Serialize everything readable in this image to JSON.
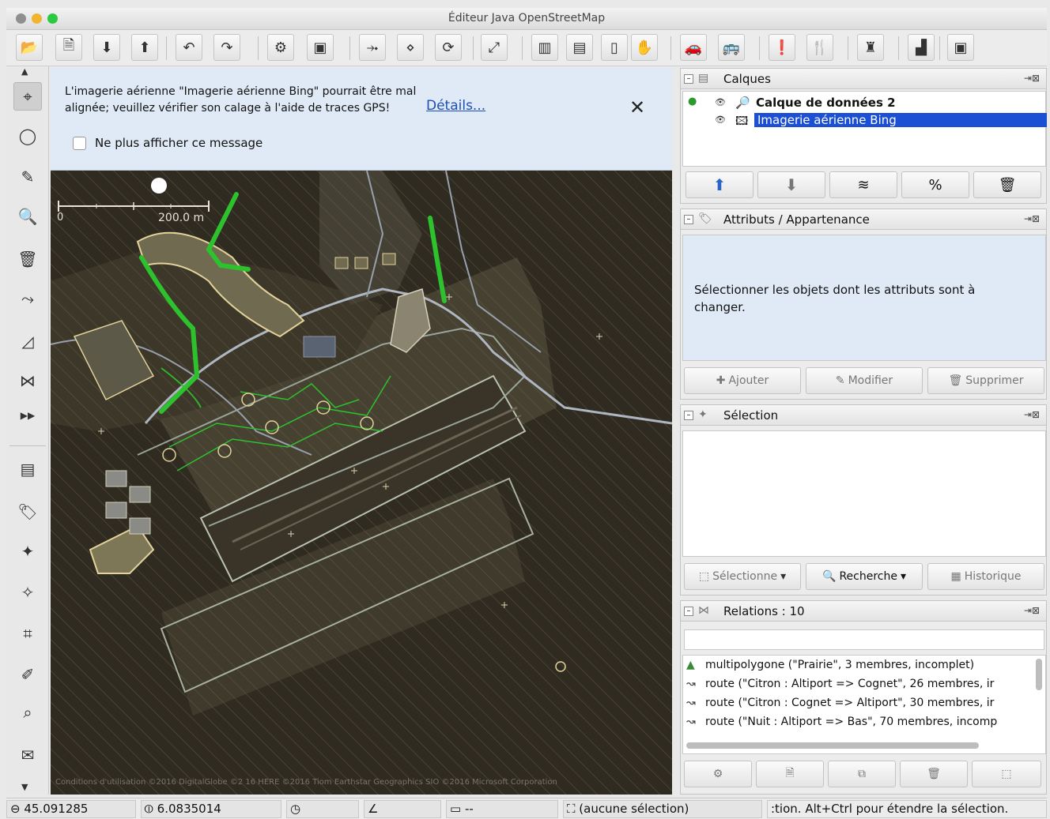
{
  "window": {
    "title": "Éditeur Java OpenStreetMap"
  },
  "toolbar": {
    "buttons": [
      {
        "name": "open-icon",
        "glyph": "📂"
      },
      {
        "name": "open-location-icon",
        "glyph": "🗎"
      },
      {
        "name": "download-icon",
        "glyph": "⬇"
      },
      {
        "name": "upload-icon",
        "glyph": "⬆"
      },
      {
        "name": "undo-icon",
        "glyph": "↶"
      },
      {
        "name": "redo-icon",
        "glyph": "↷"
      },
      {
        "name": "preferences-icon",
        "glyph": "⚙"
      },
      {
        "name": "expert-icon",
        "glyph": "▣"
      },
      {
        "name": "tracks-icon",
        "glyph": "⤞"
      },
      {
        "name": "nodes-icon",
        "glyph": "⋄"
      },
      {
        "name": "refresh-icon",
        "glyph": "⟳"
      },
      {
        "name": "zoom-fit-icon",
        "glyph": "⤢"
      },
      {
        "name": "road-icon",
        "glyph": "▥"
      },
      {
        "name": "rail-icon",
        "glyph": "▤"
      },
      {
        "name": "traffic-light-icon",
        "glyph": "▯"
      },
      {
        "name": "hand-icon",
        "glyph": "✋"
      },
      {
        "name": "car-icon",
        "glyph": "🚗"
      },
      {
        "name": "bus-icon",
        "glyph": "🚌"
      },
      {
        "name": "exclamation-icon",
        "glyph": "❗"
      },
      {
        "name": "restaurant-icon",
        "glyph": "🍴"
      },
      {
        "name": "castle-icon",
        "glyph": "♜"
      },
      {
        "name": "factory-icon",
        "glyph": "▟"
      },
      {
        "name": "more-icon",
        "glyph": "▣"
      }
    ]
  },
  "left_tools": [
    {
      "name": "select-tool-icon",
      "glyph": "⌖",
      "active": true
    },
    {
      "name": "lasso-tool-icon",
      "glyph": "◯",
      "active": false
    },
    {
      "name": "draw-tool-icon",
      "glyph": "✎",
      "active": false
    },
    {
      "name": "zoom-tool-icon",
      "glyph": "🔍",
      "active": false
    },
    {
      "name": "delete-tool-icon",
      "glyph": "🗑",
      "active": false
    },
    {
      "name": "improve-way-icon",
      "glyph": "⤳",
      "active": false
    },
    {
      "name": "parallel-way-icon",
      "glyph": "◿",
      "active": false
    },
    {
      "name": "relation-tool-icon",
      "glyph": "⋈",
      "active": false
    },
    {
      "name": "more-tools-icon",
      "glyph": "▶▶",
      "active": false
    },
    {
      "name": "layers-toggle-icon",
      "glyph": "▤",
      "active": false
    },
    {
      "name": "tags-toggle-icon",
      "glyph": "🏷",
      "active": false
    },
    {
      "name": "selection-toggle-icon",
      "glyph": "✦",
      "active": false
    },
    {
      "name": "validator-toggle-icon",
      "glyph": "✧",
      "active": false
    },
    {
      "name": "filter-toggle-icon",
      "glyph": "⌗",
      "active": false
    },
    {
      "name": "map-paint-icon",
      "glyph": "✐",
      "active": false
    },
    {
      "name": "history-toggle-icon",
      "glyph": "⌕",
      "active": false
    },
    {
      "name": "messages-toggle-icon",
      "glyph": "✉",
      "active": false
    }
  ],
  "notice": {
    "text": "L'imagerie aérienne \"Imagerie aérienne Bing\" pourrait être mal alignée; veuillez vérifier son calage à l'aide de traces GPS!",
    "link": "Détails...",
    "close": "✕",
    "checkbox_label": "Ne plus afficher ce message"
  },
  "map": {
    "scale_zero": "0",
    "scale_label": "200.0 m",
    "attribution": "Conditions d'utilisation ©2016 DigitalGlobe ©2 16 HERE ©2016 Tiom Earthstar Geographics SIO ©2016 Microsoft Corporation"
  },
  "panels": {
    "layers": {
      "title": "Calques",
      "items": [
        {
          "name": "Calque de données 2",
          "selected": false
        },
        {
          "name": "Imagerie aérienne Bing",
          "selected": true
        }
      ]
    },
    "tags": {
      "title": "Attributs / Appartenance",
      "message": "Sélectionner les objets dont les attributs sont à changer.",
      "buttons": [
        "Ajouter",
        "Modifier",
        "Supprimer"
      ]
    },
    "selection": {
      "title": "Sélection",
      "buttons": [
        "Sélectionne",
        "Recherche",
        "Historique"
      ]
    },
    "relations": {
      "title": "Relations : 10",
      "filter_placeholder": "",
      "rows": [
        {
          "icon": "multipolygon-icon",
          "text": "multipolygone (\"Prairie\", 3 membres, incomplet)"
        },
        {
          "icon": "route-icon",
          "text": "route (\"Citron : Altiport => Cognet\", 26 membres, ir"
        },
        {
          "icon": "route-icon",
          "text": "route (\"Citron : Cognet => Altiport\", 30 membres, ir"
        },
        {
          "icon": "route-icon",
          "text": "route (\"Nuit : Altiport => Bas\", 70 membres, incomp"
        }
      ]
    }
  },
  "statusbar": {
    "lat": "45.091285",
    "lon": "6.0835014",
    "heading": "",
    "angle": "",
    "distance": "--",
    "selection": "(aucune sélection)",
    "help": ":tion. Alt+Ctrl pour étendre la sélection."
  },
  "colors": {
    "selection_blue": "#1b4fd4",
    "notice_bg": "#dfeaf6",
    "map_bg": "#2f2b20",
    "route_green": "#2ec12e"
  }
}
